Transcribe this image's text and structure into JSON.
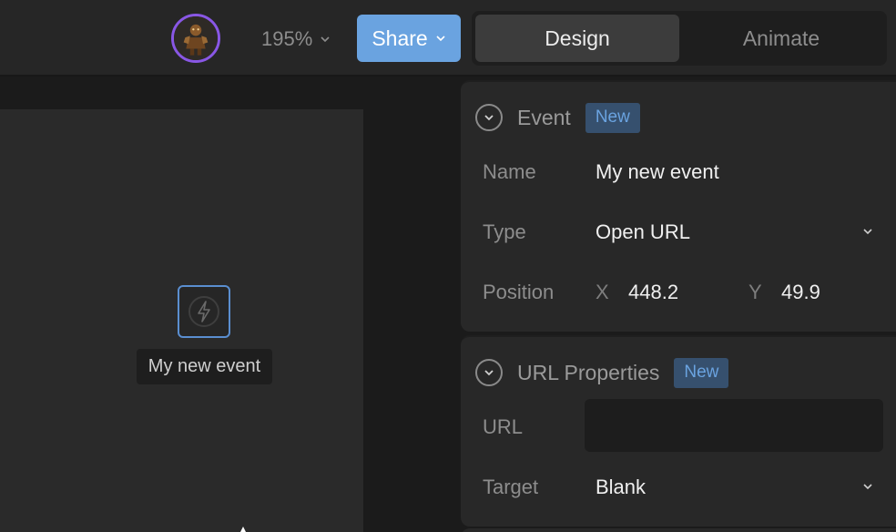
{
  "topbar": {
    "zoom": "195%",
    "share_label": "Share",
    "tabs": [
      {
        "label": "Design",
        "active": true
      },
      {
        "label": "Animate",
        "active": false
      }
    ]
  },
  "canvas": {
    "event_node_label": "My new event"
  },
  "event_section": {
    "title": "Event",
    "badge": "New",
    "name_label": "Name",
    "name_value": "My new event",
    "type_label": "Type",
    "type_value": "Open URL",
    "position_label": "Position",
    "x_axis": "X",
    "x_value": "448.2",
    "y_axis": "Y",
    "y_value": "49.9"
  },
  "url_section": {
    "title": "URL Properties",
    "badge": "New",
    "url_label": "URL",
    "url_value": "",
    "target_label": "Target",
    "target_value": "Blank"
  },
  "colors": {
    "accent": "#6aa3e0",
    "avatar_ring": "#8957e5",
    "badge_bg": "#36506e"
  },
  "icons": {
    "avatar": "user-avatar-icon",
    "event": "lightning-bolt-icon",
    "collapse": "chevron-down-icon"
  }
}
